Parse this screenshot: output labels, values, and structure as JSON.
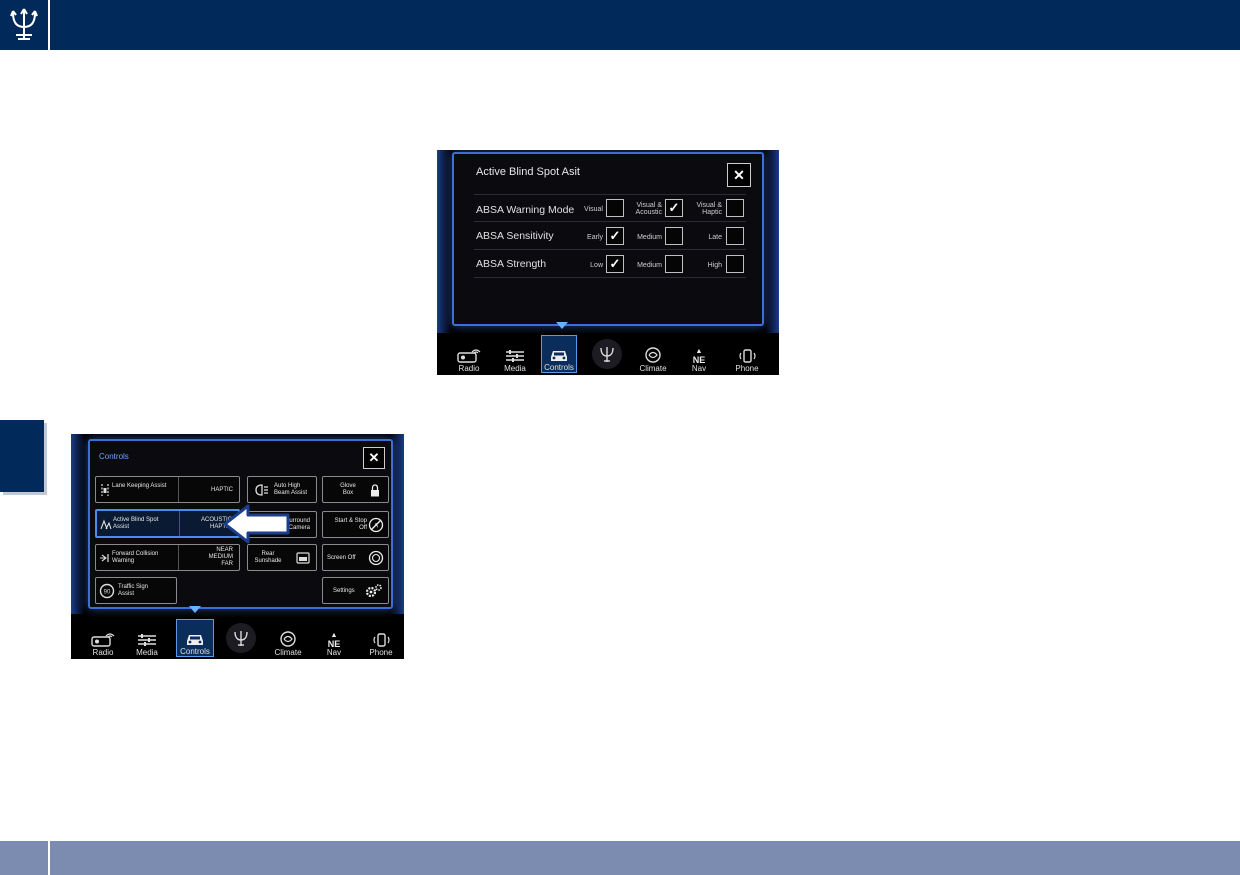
{
  "screen_top": {
    "title": "Active Blind Spot Asit",
    "rows": [
      {
        "label": "ABSA Warning Mode",
        "options": [
          {
            "label": "Visual",
            "checked": false
          },
          {
            "label": "Visual & Acoustic",
            "checked": true
          },
          {
            "label": "Visual & Haptic",
            "checked": false
          }
        ]
      },
      {
        "label": "ABSA Sensitivity",
        "options": [
          {
            "label": "Early",
            "checked": true
          },
          {
            "label": "Medium",
            "checked": false
          },
          {
            "label": "Late",
            "checked": false
          }
        ]
      },
      {
        "label": "ABSA Strength",
        "options": [
          {
            "label": "Low",
            "checked": true
          },
          {
            "label": "Medium",
            "checked": false
          },
          {
            "label": "High",
            "checked": false
          }
        ]
      }
    ],
    "check_glyph": "✓",
    "close_glyph": "✕"
  },
  "screen_bottom": {
    "title": "Controls",
    "close_glyph": "✕",
    "tiles": {
      "lane_keeping": {
        "label": "Lane Keeping Assist",
        "value": "HAPTIC"
      },
      "active_blind": {
        "label": "Active Blind Spot Assist",
        "value": "ACOUSTIC HAPTIC"
      },
      "forward_collision": {
        "label": "Forward Collision Warning",
        "value": "NEAR MEDIUM FAR"
      },
      "traffic_sign": {
        "label": "Traffic Sign Assist"
      },
      "auto_high_beam": {
        "label": "Auto High Beam Assist"
      },
      "surround_camera": {
        "label": "Surround Camera"
      },
      "rear_sunshade": {
        "label": "Rear Sunshade"
      },
      "glove_box": {
        "label": "Glove Box"
      },
      "start_stop": {
        "label": "Start & Stop Off"
      },
      "screen_off": {
        "label": "Screen Off"
      },
      "settings": {
        "label": "Settings"
      }
    }
  },
  "nav": {
    "items": [
      {
        "key": "radio",
        "label": "Radio"
      },
      {
        "key": "media",
        "label": "Media"
      },
      {
        "key": "controls",
        "label": "Controls"
      },
      {
        "key": "trident",
        "label": ""
      },
      {
        "key": "climate",
        "label": "Climate"
      },
      {
        "key": "nav",
        "label": "Nav"
      },
      {
        "key": "phone",
        "label": "Phone"
      }
    ],
    "active": "controls",
    "nav_icon_text": "NE"
  },
  "colors": {
    "brand_navy": "#012a5b",
    "footer_blue": "#7c8cb0",
    "screen_accent": "#3b6fd6"
  }
}
